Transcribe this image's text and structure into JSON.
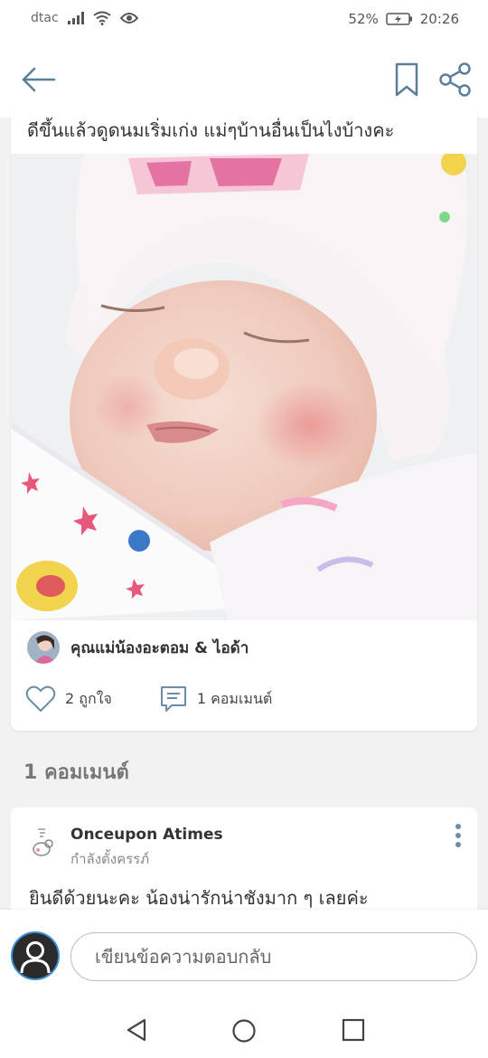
{
  "status_bar": {
    "carrier": "dtac",
    "battery": "52%",
    "time": "20:26"
  },
  "app_bar": {
    "back_icon": "back-arrow-icon",
    "bookmark_icon": "bookmark-icon",
    "share_icon": "share-icon"
  },
  "post": {
    "text": "ดีขึ้นแล้วดูดนมเริ่มเก่ง แม่ๆบ้านอื่นเป็นไงบ้างคะ",
    "author": "คุณแม่น้องอะตอม & ไอด้า",
    "likes_label": "2 ถูกใจ",
    "comments_label": "1 คอมเมนต์"
  },
  "comments_section": {
    "title": "1 คอมเมนต์",
    "items": [
      {
        "name": "Onceupon Atimes",
        "status": "กำลังตั้งครรภ์",
        "text": "ยินดีด้วยนะคะ น้องน่ารักน่าชังมาก ๆ เลยค่ะ"
      }
    ]
  },
  "reply": {
    "placeholder": "เขียนข้อความตอบกลับ"
  },
  "colors": {
    "accent": "#3a8fd6",
    "icon": "#7a9ab0",
    "background": "#f2f2f2"
  }
}
